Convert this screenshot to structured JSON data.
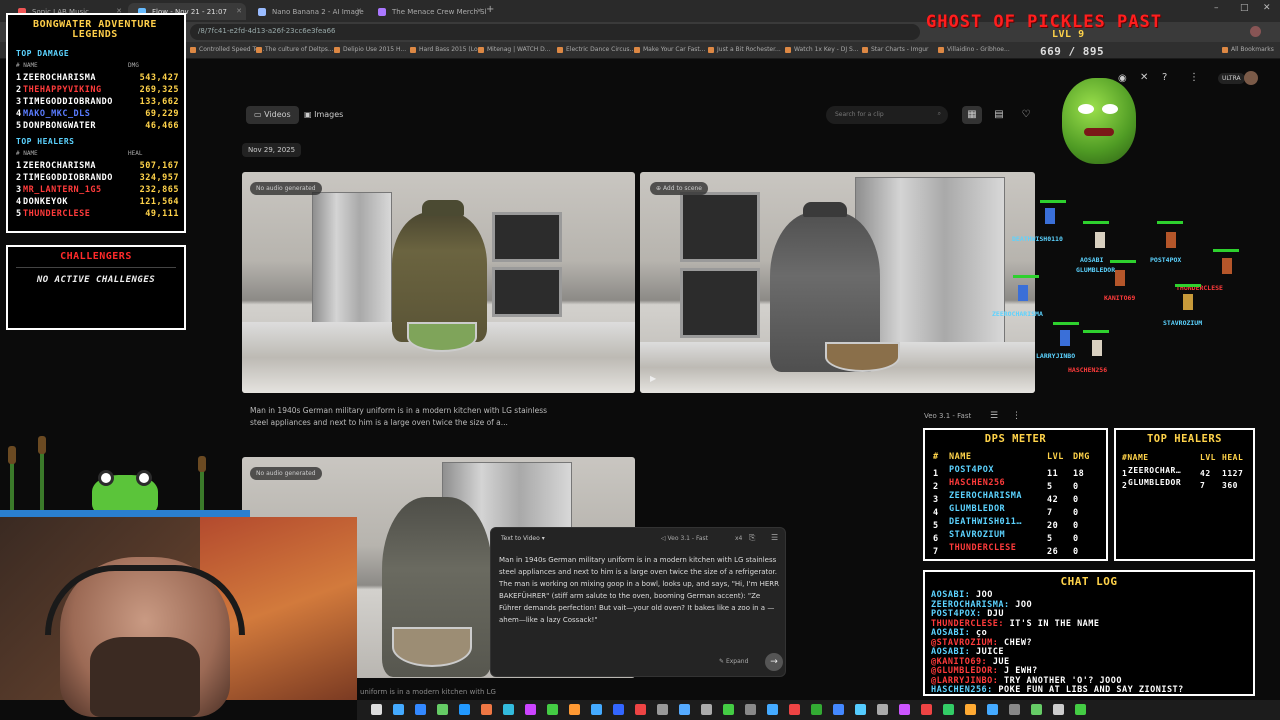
{
  "browser": {
    "tabs": [
      {
        "label": "Sonic LAB Music"
      },
      {
        "label": "Flow - Nov 21 - 21:07"
      },
      {
        "label": "Nano Banana 2 - AI Image Gen"
      },
      {
        "label": "The Menace Crew Merch Shop"
      }
    ],
    "url": "/8/7fc41-e2fd-4d13-a26f-23cc6e3fea66",
    "bookmarks": [
      "Controlled Speed Te...",
      "The culture of Deltps...",
      "Delipio Use 2015 H...",
      "Hard Bass 2015 (Lo...",
      "Mitenag | WATCH D...",
      "Electric Dance Circus...",
      "Make Your Car Fast...",
      "Just a Bit Rochester...",
      "Watch 1x Key - DJ S...",
      "Star Charts - Imgur",
      "Villaidino - Gribhoe...",
      "All Bookmarks"
    ],
    "quality_label": "ULTRA"
  },
  "page": {
    "toggle_videos": "Videos",
    "toggle_images": "Images",
    "search_placeholder": "Search for a clip",
    "date": "Nov 29, 2025",
    "card1_badge": "No audio generated",
    "card2_badge": "Add to scene",
    "card3_badge": "No audio generated",
    "caption": "Man in 1940s German military uniform is in a modern kitchen with LG stainless steel appliances and next to him is a large oven twice the size of a...",
    "model_label": "Veo 3.1 - Fast",
    "bottom_caption": "uniform is in a modern kitchen with LG"
  },
  "prompt_popup": {
    "mode": "Text to Video",
    "model": "Veo 3.1 - Fast",
    "count": "x4",
    "text": "Man in 1940s German military uniform is in a modern kitchen with LG stainless steel appliances and next to him is a large oven twice the size of a refrigerator. The man is working on mixing goop in a bowl, looks up, and says, \"Hi, I'm HERR BAKEFÜHRER\" (stiff arm salute to the oven, booming German accent): \"Ze Führer demands perfection! But vait—your old oven? It bakes like a zoo in a —ahem—like a lazy Cossack!\"",
    "expand": "Expand"
  },
  "legends": {
    "title": "BONGWATER ADVENTURE LEGENDS",
    "damage_title": "TOP DAMAGE",
    "damage_col_name": "# NAME",
    "damage_col_val": "DMG",
    "damage": [
      {
        "rank": "1",
        "name": "ZEEROCHARISMA",
        "value": "543,427",
        "color": "#ffffff"
      },
      {
        "rank": "2",
        "name": "THEHAPPYVIKING",
        "value": "269,325",
        "color": "#ff3b3b"
      },
      {
        "rank": "3",
        "name": "TIMEGODDIOBRANDO",
        "value": "133,662",
        "color": "#ffffff"
      },
      {
        "rank": "4",
        "name": "MAKO_MKC_DLS",
        "value": "69,229",
        "color": "#5a7cff"
      },
      {
        "rank": "5",
        "name": "DONPBONGWATER",
        "value": "46,466",
        "color": "#ffffff"
      }
    ],
    "healers_title": "TOP HEALERS",
    "heal_col_name": "# NAME",
    "heal_col_val": "HEAL",
    "healers": [
      {
        "rank": "1",
        "name": "ZEEROCHARISMA",
        "value": "507,167",
        "color": "#ffffff"
      },
      {
        "rank": "2",
        "name": "TIMEGODDIOBRANDO",
        "value": "324,957",
        "color": "#ffffff"
      },
      {
        "rank": "3",
        "name": "MR_LANTERN_1G5",
        "value": "232,865",
        "color": "#ff3b3b"
      },
      {
        "rank": "4",
        "name": "DONKEYOK",
        "value": "121,564",
        "color": "#ffffff"
      },
      {
        "rank": "5",
        "name": "THUNDERCLESE",
        "value": "49,111",
        "color": "#ff3b3b"
      }
    ]
  },
  "challengers": {
    "title": "CHALLENGERS",
    "message": "NO ACTIVE CHALLENGES"
  },
  "ghost": {
    "title": "GHOST OF PICKLES PAST",
    "level": "LVL 9",
    "hp": "669 / 895"
  },
  "players": [
    {
      "name": "DEATHWISH0110",
      "color": "#5cd3ff"
    },
    {
      "name": "AOSABI",
      "color": "#5cd3ff"
    },
    {
      "name": "GLUMBLEDOR",
      "color": "#5cd3ff"
    },
    {
      "name": "POST4POX",
      "color": "#5cd3ff"
    },
    {
      "name": "THUNDERCLESE",
      "color": "#ff3b3b"
    },
    {
      "name": "KANITO69",
      "color": "#ff3b3b"
    },
    {
      "name": "ZEEROCHARISMA",
      "color": "#5cd3ff"
    },
    {
      "name": "STAVROZIUM",
      "color": "#5cd3ff"
    },
    {
      "name": "LARRYJINBO",
      "color": "#5cd3ff"
    },
    {
      "name": "HASCHEN256",
      "color": "#ff3b3b"
    }
  ],
  "dps": {
    "title": "DPS METER",
    "col_rank": "#",
    "col_name": "NAME",
    "col_lvl": "LVL",
    "col_dmg": "DMG",
    "rows": [
      {
        "rank": "1",
        "name": "POST4POX",
        "lvl": "11",
        "dmg": "18",
        "color": "#5cd3ff"
      },
      {
        "rank": "2",
        "name": "HASCHEN256",
        "lvl": "5",
        "dmg": "0",
        "color": "#ff3b3b"
      },
      {
        "rank": "3",
        "name": "ZEEROCHARISMA",
        "lvl": "42",
        "dmg": "0",
        "color": "#5cd3ff"
      },
      {
        "rank": "4",
        "name": "GLUMBLEDOR",
        "lvl": "7",
        "dmg": "0",
        "color": "#5cd3ff"
      },
      {
        "rank": "5",
        "name": "DEATHWISH011…",
        "lvl": "20",
        "dmg": "0",
        "color": "#5cd3ff"
      },
      {
        "rank": "6",
        "name": "STAVROZIUM",
        "lvl": "5",
        "dmg": "0",
        "color": "#5cd3ff"
      },
      {
        "rank": "7",
        "name": "THUNDERCLESE",
        "lvl": "26",
        "dmg": "0",
        "color": "#ff3b3b"
      }
    ]
  },
  "top_healers_panel": {
    "title": "TOP HEALERS",
    "col_name": "#NAME",
    "col_lvl": "LVL",
    "col_heal": "HEAL",
    "rows": [
      {
        "rank": "1",
        "name": "ZEEROCHAR…",
        "lvl": "42",
        "heal": "1127"
      },
      {
        "rank": "2",
        "name": "GLUMBLEDOR",
        "lvl": "7",
        "heal": "360"
      }
    ]
  },
  "chat": {
    "title": "CHAT LOG",
    "messages": [
      {
        "user": "AOSABI:",
        "text": "JOO",
        "ucolor": "#5cd3ff"
      },
      {
        "user": "ZEEROCHARISMA:",
        "text": "JOO",
        "ucolor": "#5cd3ff"
      },
      {
        "user": "POST4POX:",
        "text": "DJU",
        "ucolor": "#5cd3ff"
      },
      {
        "user": "THUNDERCLESE:",
        "text": "IT'S IN THE NAME",
        "ucolor": "#ff3b3b"
      },
      {
        "user": "AOSABI:",
        "text": "ço",
        "ucolor": "#5cd3ff"
      },
      {
        "user": "@STAVROZIUM:",
        "text": "CHEW?",
        "ucolor": "#ff3b3b"
      },
      {
        "user": "AOSABI:",
        "text": "JUICE",
        "ucolor": "#5cd3ff"
      },
      {
        "user": "@KANITO69:",
        "text": "JUE",
        "ucolor": "#ff3b3b"
      },
      {
        "user": "@GLUMBLEDOR:",
        "text": "J EWH?",
        "ucolor": "#ff3b3b"
      },
      {
        "user": "@LARRYJINBO:",
        "text": "TRY ANOTHER 'O'? JOOO",
        "ucolor": "#ff3b3b"
      },
      {
        "user": "HASCHEN256:",
        "text": "POKE FUN AT LIBS AND SAY ZIONIST?",
        "ucolor": "#5cd3ff"
      }
    ]
  },
  "colors": {
    "accent_gold": "#ffd34a",
    "accent_blue": "#5cd3ff",
    "accent_red": "#ff3b3b",
    "hp_green": "#2ed12e"
  }
}
